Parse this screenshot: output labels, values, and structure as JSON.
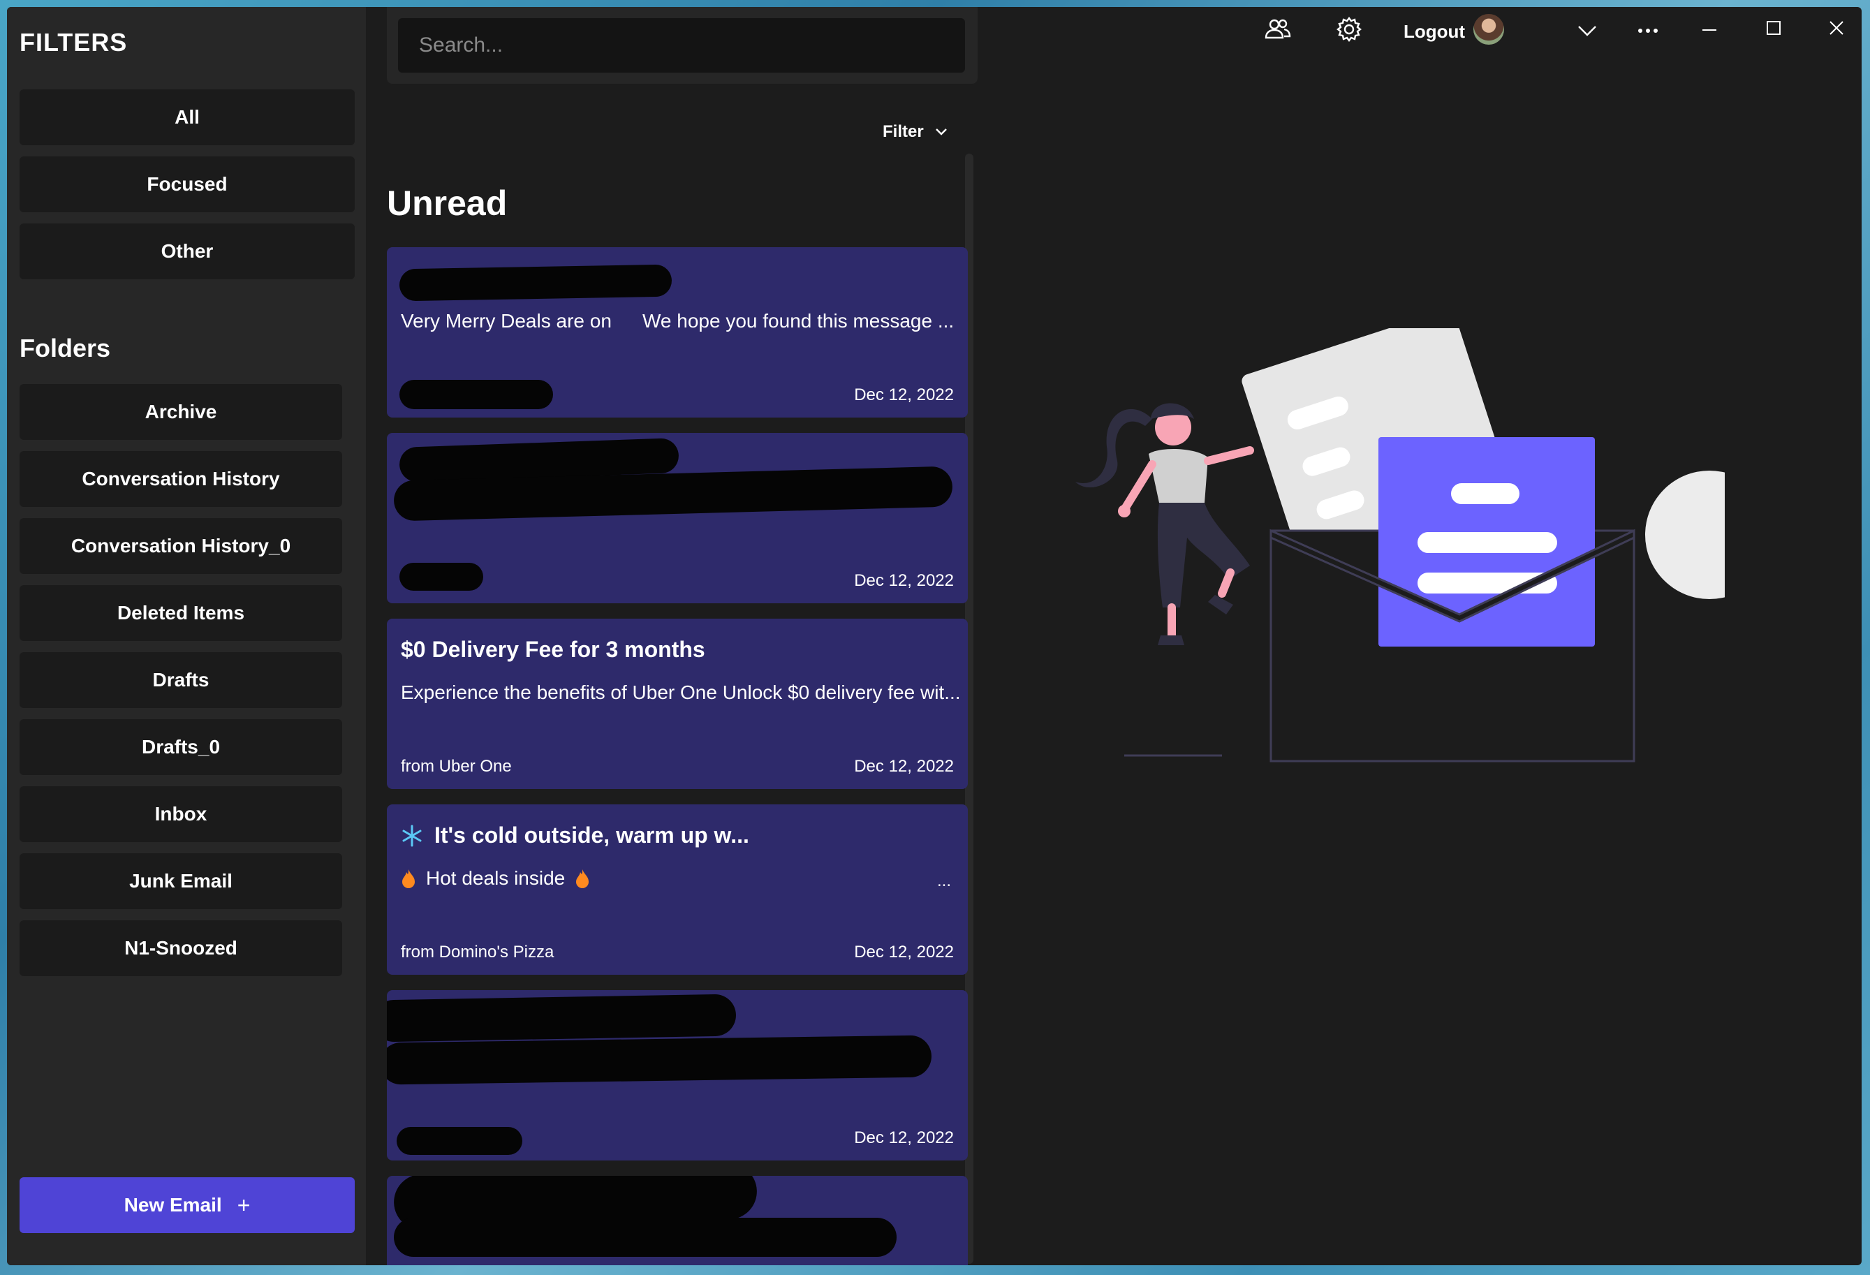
{
  "sidebar": {
    "filters_title": "FILTERS",
    "filters": [
      "All",
      "Focused",
      "Other"
    ],
    "folders_title": "Folders",
    "folders": [
      "Archive",
      "Conversation History",
      "Conversation History_0",
      "Deleted Items",
      "Drafts",
      "Drafts_0",
      "Inbox",
      "Junk Email",
      "N1-Snoozed"
    ],
    "new_email_label": "New Email",
    "new_email_icon": "+"
  },
  "search": {
    "placeholder": "Search..."
  },
  "list": {
    "filter_label": "Filter",
    "heading": "Unread",
    "cards": [
      {
        "title": "",
        "preview": "Very Merry Deals are on",
        "preview2": "We hope you found this message ...",
        "from": "",
        "date": "Dec 12, 2022"
      },
      {
        "title": "",
        "preview": "",
        "preview2": "",
        "from": "",
        "date": "Dec 12, 2022"
      },
      {
        "title": "$0 Delivery Fee for 3 months",
        "preview": "Experience the benefits of Uber One Unlock $0 delivery fee wit...",
        "preview2": "",
        "from": "from Uber One",
        "date": "Dec 12, 2022"
      },
      {
        "title": "It's cold outside, warm up w...",
        "preview": "Hot deals inside",
        "preview2": "",
        "ellipsis": "...",
        "from": "from Domino's Pizza",
        "date": "Dec 12, 2022"
      },
      {
        "title": "",
        "preview": "",
        "preview2": "",
        "from": "",
        "date": "Dec 12, 2022"
      },
      {
        "title": "",
        "preview": "",
        "preview2": "",
        "from": "",
        "date": ""
      }
    ]
  },
  "titlebar": {
    "logout_label": "Logout",
    "icons": [
      "people-icon",
      "gear-icon",
      "avatar",
      "chevron-down-icon",
      "more-icon",
      "minimize-icon",
      "maximize-icon",
      "close-icon"
    ]
  },
  "colors": {
    "accent": "#4f44d6",
    "card": "#2e2a6b",
    "illustration_purple": "#6c63ff",
    "illustration_pink": "#f8a5b5"
  }
}
